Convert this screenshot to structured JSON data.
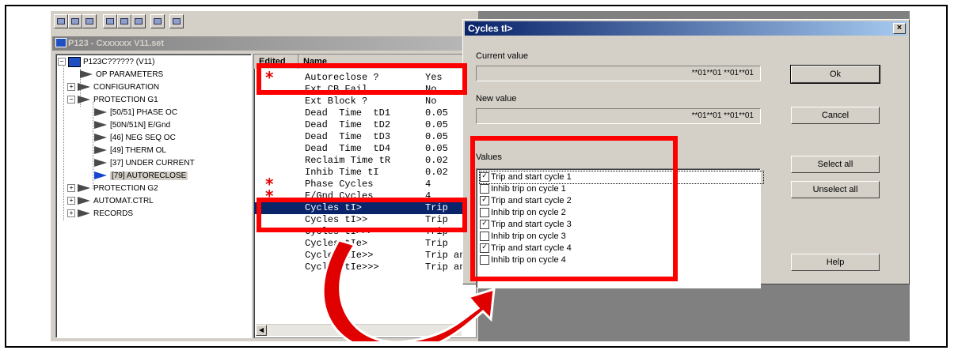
{
  "toolbar": {
    "icons": [
      "new-icon",
      "open-icon",
      "save-icon",
      "cut-icon",
      "copy-icon",
      "paste-icon",
      "print-icon",
      "help-icon"
    ]
  },
  "left_window": {
    "title": "P123 - Cxxxxxx V11.set",
    "tree": {
      "root": "P123C?????? (V11)",
      "items": [
        {
          "label": "OP PARAMETERS"
        },
        {
          "label": "CONFIGURATION"
        },
        {
          "label": "PROTECTION G1"
        },
        {
          "label": "[50/51] PHASE OC"
        },
        {
          "label": "[50N/51N] E/Gnd"
        },
        {
          "label": "[46] NEG SEQ OC"
        },
        {
          "label": "[49] THERM OL"
        },
        {
          "label": "[37] UNDER CURRENT"
        },
        {
          "label": "[79] AUTORECLOSE"
        },
        {
          "label": "PROTECTION G2"
        },
        {
          "label": "AUTOMAT.CTRL"
        },
        {
          "label": "RECORDS"
        }
      ]
    },
    "list": {
      "columns": [
        "Edited",
        "Name"
      ],
      "rows": [
        {
          "name": "Autoreclose ?",
          "value": "Yes"
        },
        {
          "name": "Ext CB Fail",
          "value": "No"
        },
        {
          "name": "Ext Block ?",
          "value": "No"
        },
        {
          "name": "Dead  Time  tD1",
          "value": "0.05"
        },
        {
          "name": "Dead  Time  tD2",
          "value": "0.05"
        },
        {
          "name": "Dead  Time  tD3",
          "value": "0.05"
        },
        {
          "name": "Dead  Time  tD4",
          "value": "0.05"
        },
        {
          "name": "Reclaim Time tR",
          "value": "0.02"
        },
        {
          "name": "Inhib Time tI",
          "value": "0.02"
        },
        {
          "name": "Phase Cycles",
          "value": "4"
        },
        {
          "name": "E/Gnd Cycles",
          "value": "4"
        },
        {
          "name": "Cycles tI>",
          "value": "Trip"
        },
        {
          "name": "Cycles tI>>",
          "value": "Trip"
        },
        {
          "name": "Cycles tI>>>",
          "value": "Trip"
        },
        {
          "name": "Cycles tIe>",
          "value": "Trip"
        },
        {
          "name": "Cycles tIe>>",
          "value": "Trip and start cyc"
        },
        {
          "name": "Cycles tIe>>>",
          "value": "Trip and start cyc"
        }
      ]
    }
  },
  "dialog": {
    "title": "Cycles tI>",
    "close": "×",
    "current_label": "Current value",
    "current_value": "**01**01 **01**01",
    "new_label": "New value",
    "new_value": "**01**01 **01**01",
    "values_label": "Values",
    "options": [
      {
        "label": "Trip and start cycle 1",
        "checked": true
      },
      {
        "label": "Inhib trip on cycle 1",
        "checked": false
      },
      {
        "label": "Trip and start cycle 2",
        "checked": true
      },
      {
        "label": "Inhib trip on cycle 2",
        "checked": false
      },
      {
        "label": "Trip and start cycle 3",
        "checked": true
      },
      {
        "label": "Inhib trip on cycle 3",
        "checked": false
      },
      {
        "label": "Trip and start cycle 4",
        "checked": true
      },
      {
        "label": "Inhib trip on cycle 4",
        "checked": false
      }
    ],
    "buttons": {
      "ok": "Ok",
      "cancel": "Cancel",
      "select_all": "Select all",
      "unselect_all": "Unselect all",
      "help": "Help"
    }
  },
  "annotation": {
    "highlight_color": "#ff0000",
    "selection_color": "#0a246a"
  }
}
